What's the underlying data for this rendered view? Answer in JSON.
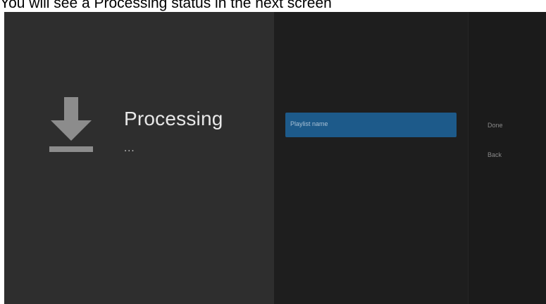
{
  "caption": "You will see a Processing status in the next screen",
  "status": {
    "title": "Processing",
    "dots": "..."
  },
  "form": {
    "playlist_name_label": "Playlist name"
  },
  "actions": {
    "done_label": "Done",
    "back_label": "Back"
  },
  "icons": {
    "status_icon": "download-icon"
  },
  "colors": {
    "screen_bg": "#1b1b1b",
    "left_panel_bg": "#2e2e2e",
    "accent_field": "#1d5a8a",
    "icon_gray": "#8c8c8c"
  }
}
